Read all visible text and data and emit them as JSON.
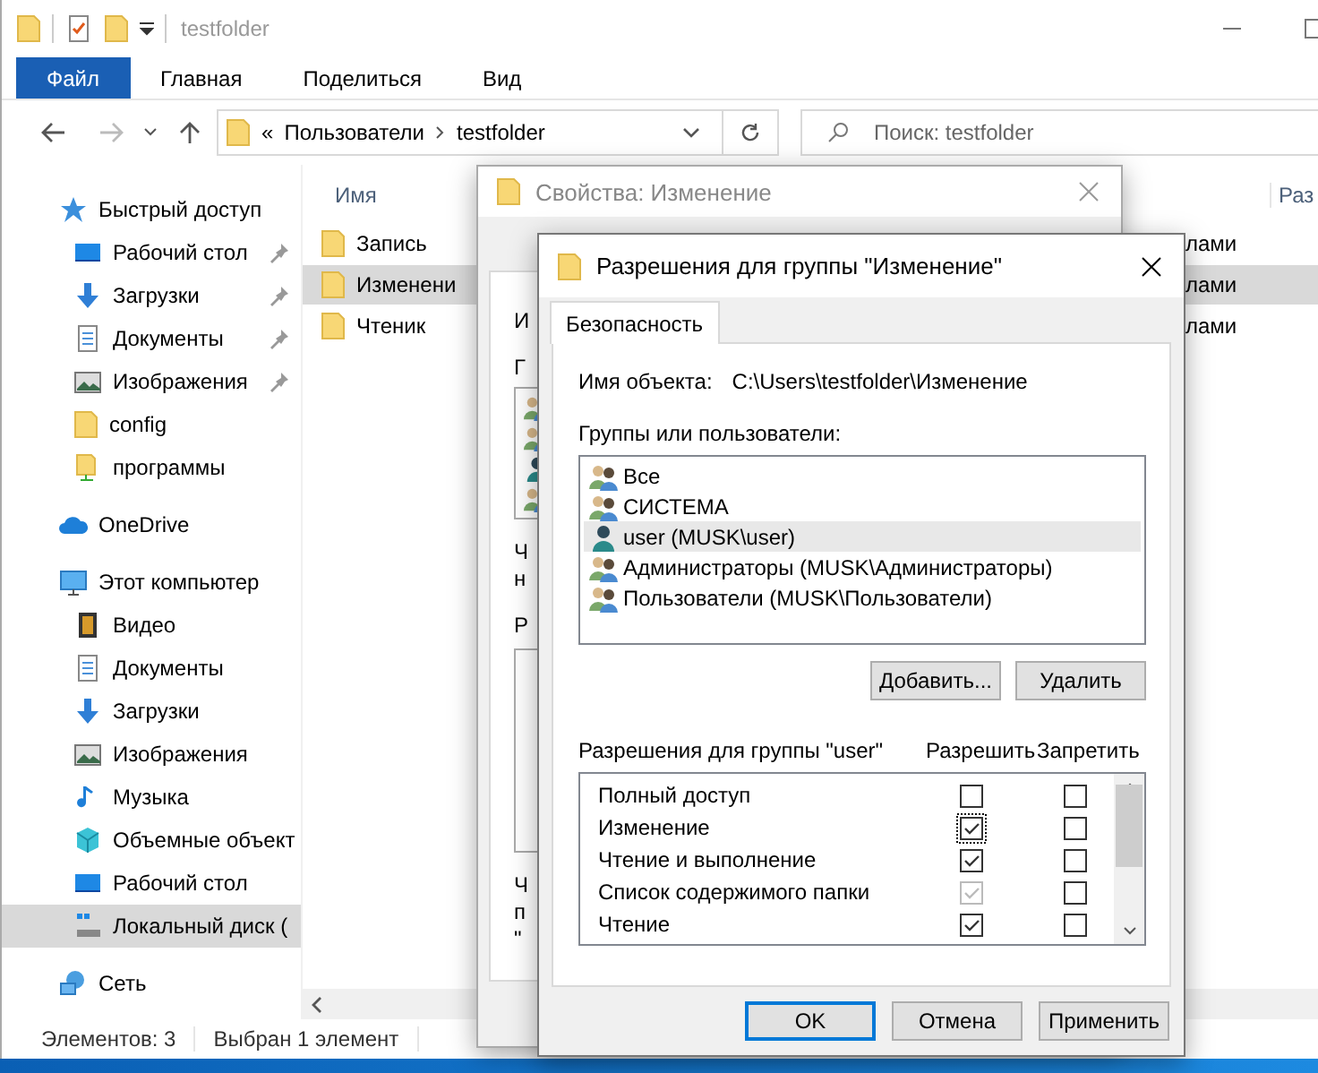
{
  "explorer": {
    "title": "testfolder",
    "ribbon_tabs": [
      {
        "label": "Файл",
        "selected": true
      },
      {
        "label": "Главная",
        "selected": false
      },
      {
        "label": "Поделиться",
        "selected": false
      },
      {
        "label": "Вид",
        "selected": false
      }
    ],
    "address": {
      "overflow": "«",
      "path": [
        "Пользователи",
        "testfolder"
      ]
    },
    "search": {
      "placeholder": "Поиск: testfolder"
    },
    "sidebar": [
      {
        "label": "Быстрый доступ",
        "kind": "star",
        "selected": false,
        "children": [
          {
            "label": "Рабочий стол",
            "kind": "desktop",
            "pinned": true,
            "selected": false
          },
          {
            "label": "Загрузки",
            "kind": "download",
            "pinned": true,
            "selected": false
          },
          {
            "label": "Документы",
            "kind": "docs",
            "pinned": true,
            "selected": false
          },
          {
            "label": "Изображения",
            "kind": "pictures",
            "pinned": true,
            "selected": false
          },
          {
            "label": "config",
            "kind": "folder",
            "pinned": false,
            "selected": false
          },
          {
            "label": "программы",
            "kind": "netfolder",
            "pinned": false,
            "selected": false
          }
        ]
      },
      {
        "label": "OneDrive",
        "kind": "cloud",
        "selected": false
      },
      {
        "label": "Этот компьютер",
        "kind": "computer",
        "selected": false,
        "children": [
          {
            "label": "Видео",
            "kind": "video",
            "pinned": false,
            "selected": false
          },
          {
            "label": "Документы",
            "kind": "docs",
            "pinned": false,
            "selected": false
          },
          {
            "label": "Загрузки",
            "kind": "download",
            "pinned": false,
            "selected": false
          },
          {
            "label": "Изображения",
            "kind": "pictures",
            "pinned": false,
            "selected": false
          },
          {
            "label": "Музыка",
            "kind": "music",
            "pinned": false,
            "selected": false
          },
          {
            "label": "Объемные объект",
            "kind": "cube",
            "pinned": false,
            "selected": false
          },
          {
            "label": "Рабочий стол",
            "kind": "desktop",
            "pinned": false,
            "selected": false
          },
          {
            "label": "Локальный диск (",
            "kind": "drive",
            "pinned": false,
            "selected": true
          }
        ]
      },
      {
        "label": "Сеть",
        "kind": "network",
        "selected": false
      }
    ],
    "columns": [
      "Имя",
      "Раз"
    ],
    "files": [
      {
        "name": "Запись",
        "type": "лами",
        "selected": false
      },
      {
        "name": "Изменени",
        "type": "лами",
        "selected": true
      },
      {
        "name": "Чтеник",
        "type": "лами",
        "selected": false
      }
    ],
    "status": [
      "Элементов: 3",
      "Выбран 1 элемент"
    ]
  },
  "properties_dialog": {
    "title": "Свойства: Изменение",
    "blocks": [
      {
        "kind": "text",
        "lines": [
          "И"
        ]
      },
      {
        "kind": "text",
        "lines": [
          "Г"
        ]
      },
      {
        "kind": "userlist"
      },
      {
        "kind": "text",
        "lines": [
          "Ч",
          "н"
        ]
      },
      {
        "kind": "text",
        "lines": [
          "Р"
        ]
      },
      {
        "kind": "box"
      },
      {
        "kind": "text",
        "lines": [
          "Ч",
          "п",
          "\""
        ]
      }
    ]
  },
  "permissions_dialog": {
    "title": "Разрешения для группы \"Изменение\"",
    "tabs": [
      {
        "label": "Безопасность",
        "selected": true
      }
    ],
    "object_label": "Имя объекта:",
    "object_path": "C:\\Users\\testfolder\\Изменение",
    "groups_label": "Группы или пользователи:",
    "principals": [
      {
        "name": "Все",
        "kind": "group",
        "selected": false
      },
      {
        "name": "СИСТЕМА",
        "kind": "group",
        "selected": false
      },
      {
        "name": "user (MUSK\\user)",
        "kind": "user",
        "selected": true
      },
      {
        "name": "Администраторы (MUSK\\Администраторы)",
        "kind": "group",
        "selected": false
      },
      {
        "name": "Пользователи (MUSK\\Пользователи)",
        "kind": "group",
        "selected": false
      }
    ],
    "buttons": [
      "Добавить...",
      "Удалить"
    ],
    "perm_label": "Разрешения для группы \"user\"",
    "perm_columns": [
      "Разрешить",
      "Запретить"
    ],
    "permissions": [
      {
        "name": "Полный доступ",
        "allow": false,
        "deny": false,
        "disabled": false,
        "focused": false
      },
      {
        "name": "Изменение",
        "allow": true,
        "deny": false,
        "disabled": false,
        "focused": true
      },
      {
        "name": "Чтение и выполнение",
        "allow": true,
        "deny": false,
        "disabled": false,
        "focused": false
      },
      {
        "name": "Список содержимого папки",
        "allow": true,
        "deny": false,
        "disabled": true,
        "focused": false
      },
      {
        "name": "Чтение",
        "allow": true,
        "deny": false,
        "disabled": false,
        "focused": false
      }
    ],
    "footer": [
      {
        "label": "OK",
        "default": true
      },
      {
        "label": "Отмена",
        "default": false
      },
      {
        "label": "Применить",
        "default": false
      }
    ]
  }
}
